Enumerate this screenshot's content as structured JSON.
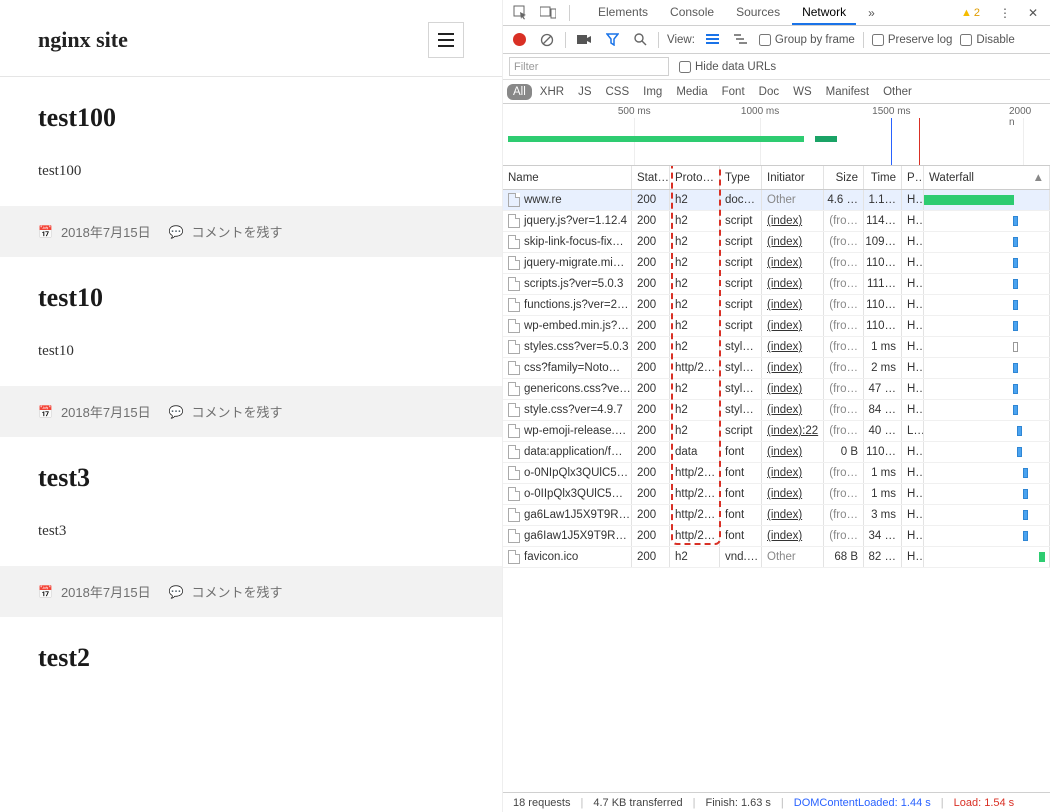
{
  "site": {
    "title": "nginx site",
    "posts": [
      {
        "title": "test100",
        "body": "test100",
        "date": "2018年7月15日",
        "comment": "コメントを残す"
      },
      {
        "title": "test10",
        "body": "test10",
        "date": "2018年7月15日",
        "comment": "コメントを残す"
      },
      {
        "title": "test3",
        "body": "test3",
        "date": "2018年7月15日",
        "comment": "コメントを残す"
      },
      {
        "title": "test2",
        "body": "",
        "date": "",
        "comment": ""
      }
    ]
  },
  "devtools": {
    "tabs": [
      "Elements",
      "Console",
      "Sources",
      "Network"
    ],
    "active_tab": "Network",
    "warnings": "2",
    "toolbar": {
      "view_label": "View:",
      "group_by_frame": "Group by frame",
      "preserve_log": "Preserve log",
      "disable": "Disable"
    },
    "filter": {
      "placeholder": "Filter",
      "hide_urls": "Hide data URLs"
    },
    "types": [
      "All",
      "XHR",
      "JS",
      "CSS",
      "Img",
      "Media",
      "Font",
      "Doc",
      "WS",
      "Manifest",
      "Other"
    ],
    "timeline_ticks": [
      "500 ms",
      "1000 ms",
      "1500 ms",
      "2000 n"
    ],
    "columns": [
      "Name",
      "Stat…",
      "Proto…",
      "Type",
      "Initiator",
      "Size",
      "Time",
      "P…",
      "Waterfall"
    ],
    "rows": [
      {
        "name": "www.re",
        "status": "200",
        "proto": "h2",
        "type": "doc…",
        "init": "Other",
        "init_gray": true,
        "size": "4.6 …",
        "time": "1.1…",
        "pri": "H…",
        "wf": {
          "type": "green",
          "w": 72,
          "l": 0
        },
        "sel": true
      },
      {
        "name": "jquery.js?ver=1.12.4",
        "status": "200",
        "proto": "h2",
        "type": "script",
        "init": "(index)",
        "size": "(fro…",
        "size_gray": true,
        "time": "114…",
        "pri": "H…",
        "wf": {
          "type": "blue",
          "w": 4,
          "l": 71
        }
      },
      {
        "name": "skip-link-focus-fix…",
        "status": "200",
        "proto": "h2",
        "type": "script",
        "init": "(index)",
        "size": "(fro…",
        "size_gray": true,
        "time": "109…",
        "pri": "H…",
        "wf": {
          "type": "blue",
          "w": 4,
          "l": 71
        }
      },
      {
        "name": "jquery-migrate.mi…",
        "status": "200",
        "proto": "h2",
        "type": "script",
        "init": "(index)",
        "size": "(fro…",
        "size_gray": true,
        "time": "110…",
        "pri": "H…",
        "wf": {
          "type": "blue",
          "w": 4,
          "l": 71
        }
      },
      {
        "name": "scripts.js?ver=5.0.3",
        "status": "200",
        "proto": "h2",
        "type": "script",
        "init": "(index)",
        "size": "(fro…",
        "size_gray": true,
        "time": "111…",
        "pri": "H…",
        "wf": {
          "type": "blue",
          "w": 4,
          "l": 71
        }
      },
      {
        "name": "functions.js?ver=2…",
        "status": "200",
        "proto": "h2",
        "type": "script",
        "init": "(index)",
        "size": "(fro…",
        "size_gray": true,
        "time": "110…",
        "pri": "H…",
        "wf": {
          "type": "blue",
          "w": 4,
          "l": 71
        }
      },
      {
        "name": "wp-embed.min.js?…",
        "status": "200",
        "proto": "h2",
        "type": "script",
        "init": "(index)",
        "size": "(fro…",
        "size_gray": true,
        "time": "110…",
        "pri": "H…",
        "wf": {
          "type": "blue",
          "w": 4,
          "l": 71
        }
      },
      {
        "name": "styles.css?ver=5.0.3",
        "status": "200",
        "proto": "h2",
        "type": "styl…",
        "init": "(index)",
        "size": "(fro…",
        "size_gray": true,
        "time": "1 ms",
        "pri": "H…",
        "wf": {
          "type": "outline",
          "w": 4,
          "l": 71
        }
      },
      {
        "name": "css?family=Noto…",
        "status": "200",
        "proto": "http/2…",
        "type": "styl…",
        "init": "(index)",
        "size": "(fro…",
        "size_gray": true,
        "time": "2 ms",
        "pri": "H…",
        "wf": {
          "type": "blue",
          "w": 4,
          "l": 71
        }
      },
      {
        "name": "genericons.css?ve…",
        "status": "200",
        "proto": "h2",
        "type": "styl…",
        "init": "(index)",
        "size": "(fro…",
        "size_gray": true,
        "time": "47 …",
        "pri": "H…",
        "wf": {
          "type": "blue",
          "w": 4,
          "l": 71
        }
      },
      {
        "name": "style.css?ver=4.9.7",
        "status": "200",
        "proto": "h2",
        "type": "styl…",
        "init": "(index)",
        "size": "(fro…",
        "size_gray": true,
        "time": "84 …",
        "pri": "H…",
        "wf": {
          "type": "blue",
          "w": 4,
          "l": 71
        }
      },
      {
        "name": "wp-emoji-release.…",
        "status": "200",
        "proto": "h2",
        "type": "script",
        "init": "(index):22",
        "size": "(fro…",
        "size_gray": true,
        "time": "40 …",
        "pri": "L…",
        "wf": {
          "type": "blue",
          "w": 4,
          "l": 74
        }
      },
      {
        "name": "data:application/f…",
        "status": "200",
        "proto": "data",
        "type": "font",
        "init": "(index)",
        "size": "0 B",
        "time": "110…",
        "pri": "H…",
        "wf": {
          "type": "blue",
          "w": 4,
          "l": 74
        }
      },
      {
        "name": "o-0NIpQlx3QUlC5…",
        "status": "200",
        "proto": "http/2…",
        "type": "font",
        "init": "(index)",
        "size": "(fro…",
        "size_gray": true,
        "time": "1 ms",
        "pri": "H…",
        "wf": {
          "type": "blue",
          "w": 4,
          "l": 79
        }
      },
      {
        "name": "o-0IIpQlx3QUlC5…",
        "status": "200",
        "proto": "http/2…",
        "type": "font",
        "init": "(index)",
        "size": "(fro…",
        "size_gray": true,
        "time": "1 ms",
        "pri": "H…",
        "wf": {
          "type": "blue",
          "w": 4,
          "l": 79
        }
      },
      {
        "name": "ga6Law1J5X9T9R…",
        "status": "200",
        "proto": "http/2…",
        "type": "font",
        "init": "(index)",
        "size": "(fro…",
        "size_gray": true,
        "time": "3 ms",
        "pri": "H…",
        "wf": {
          "type": "blue",
          "w": 4,
          "l": 79
        }
      },
      {
        "name": "ga6Iaw1J5X9T9R…",
        "status": "200",
        "proto": "http/2…",
        "type": "font",
        "init": "(index)",
        "size": "(fro…",
        "size_gray": true,
        "time": "34 …",
        "pri": "H…",
        "wf": {
          "type": "blue",
          "w": 4,
          "l": 79
        }
      },
      {
        "name": "favicon.ico",
        "status": "200",
        "proto": "h2",
        "type": "vnd.…",
        "init": "Other",
        "init_gray": true,
        "size": "68 B",
        "time": "82 …",
        "pri": "H…",
        "wf": {
          "type": "green",
          "w": 5,
          "l": 92
        }
      }
    ],
    "status": {
      "requests": "18 requests",
      "transferred": "4.7 KB transferred",
      "finish": "Finish: 1.63 s",
      "dcl_label": "DOMContentLoaded:",
      "dcl_val": "1.44 s",
      "load_label": "Load:",
      "load_val": "1.54 s"
    }
  }
}
